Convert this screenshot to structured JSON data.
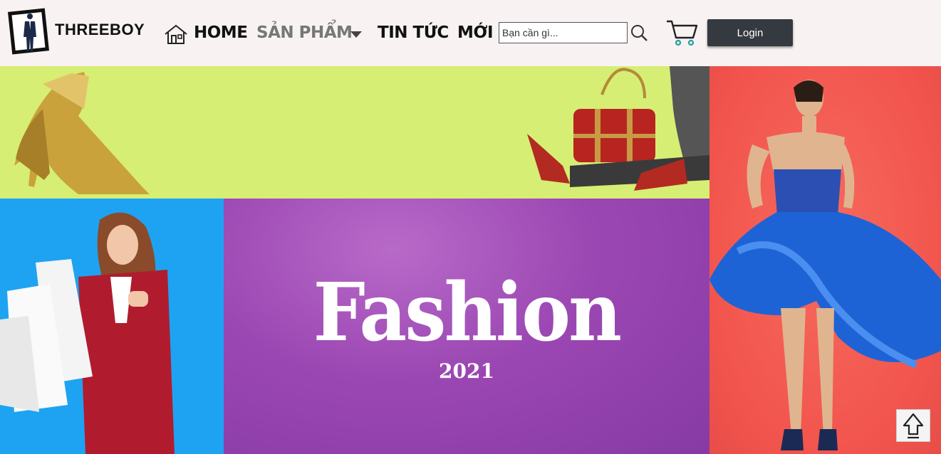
{
  "header": {
    "logo_text": "THREEBOY",
    "nav": {
      "home": "HOME",
      "products": "SẢN PHẨM",
      "news": "TIN TỨC",
      "new": "MỚI"
    },
    "search": {
      "placeholder": "Bạn cần gì..."
    },
    "login_label": "Login"
  },
  "banner": {
    "title": "Fashion",
    "year": "2021",
    "colors": {
      "top_panel": "#d6ee73",
      "left_panel": "#1ea3f2",
      "middle_panel": "#9b47b3",
      "right_panel": "#f2554d"
    }
  },
  "icons": [
    "home-icon",
    "chevron-down-icon",
    "search-icon",
    "cart-icon",
    "arrow-up-icon"
  ]
}
